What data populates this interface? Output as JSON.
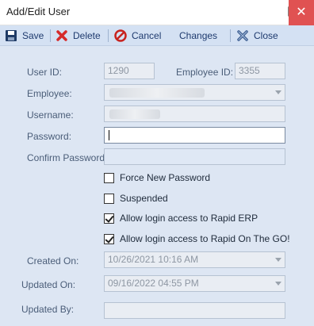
{
  "window": {
    "title": "Add/Edit User",
    "close_glyph": "✕"
  },
  "toolbar": {
    "save": "Save",
    "delete": "Delete",
    "cancel": "Cancel",
    "changes": "Changes",
    "close": "Close"
  },
  "form": {
    "user_id_label": "User ID:",
    "user_id_value": "1290",
    "employee_id_label": "Employee ID:",
    "employee_id_value": "3355",
    "employee_label": "Employee:",
    "username_label": "Username:",
    "password_label": "Password:",
    "confirm_password_label": "Confirm Password:",
    "force_new_password": {
      "label": "Force New Password",
      "checked": false
    },
    "suspended": {
      "label": "Suspended",
      "checked": false
    },
    "allow_rapid_erp": {
      "label": "Allow login access to Rapid ERP",
      "checked": true
    },
    "allow_rapid_go": {
      "label": "Allow login access to Rapid On The GO!",
      "checked": true
    },
    "created_on_label": "Created On:",
    "created_on_value": "10/26/2021 10:16 AM",
    "updated_on_label": "Updated On:",
    "updated_on_value": "09/16/2022 04:55 PM",
    "updated_by_label": "Updated By:",
    "updated_by_value": ""
  },
  "colors": {
    "form_background": "#dde6f3",
    "toolbar_background": "#d4e1f3",
    "close_button": "#e05252",
    "delete_icon": "#d62a2a",
    "cancel_icon": "#c8231f"
  },
  "icons": [
    "floppy-disk-icon",
    "red-x-icon",
    "no-entry-icon",
    "close-x-icon",
    "mouse-cursor-icon"
  ]
}
